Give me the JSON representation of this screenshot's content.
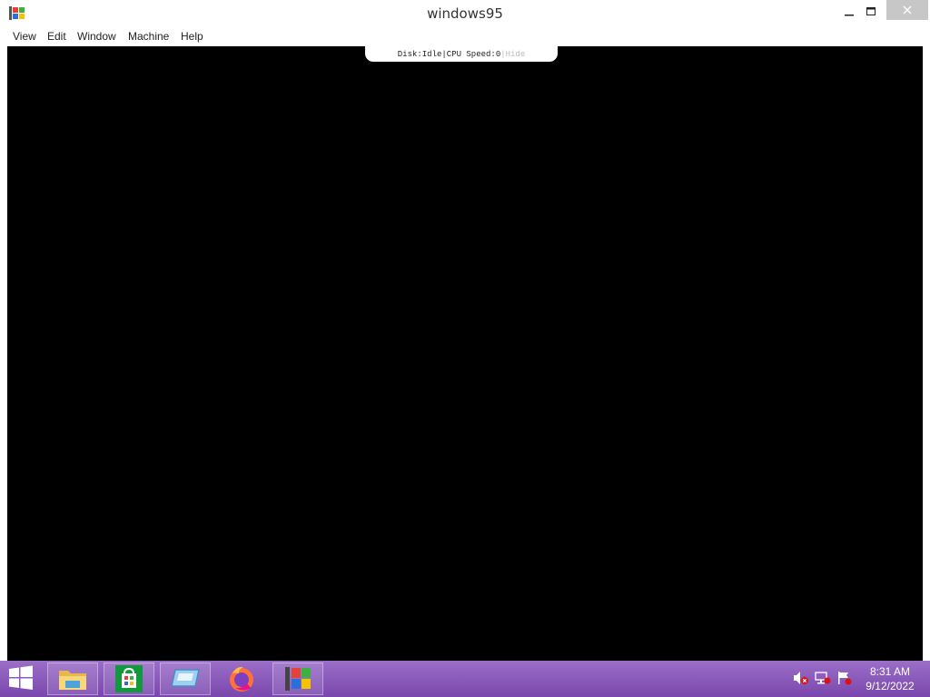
{
  "window": {
    "title": "windows95",
    "icon": "windows-flag-icon",
    "controls": {
      "minimize": "minimize-icon",
      "maximize": "maximize-icon",
      "close": "close-icon"
    }
  },
  "menubar": {
    "items": [
      "View",
      "Edit",
      "Window",
      "Machine",
      "Help"
    ]
  },
  "status": {
    "disk_label": "Disk:",
    "disk_value": "Idle",
    "separator": "|",
    "cpu_label": "CPU Speed:",
    "cpu_value": "0",
    "hide_label": "Hide"
  },
  "taskbar": {
    "start": "windows-start-icon",
    "apps": [
      {
        "name": "file-explorer",
        "icon": "folder-icon",
        "active": true
      },
      {
        "name": "store",
        "icon": "store-bag-icon",
        "active": true
      },
      {
        "name": "remote-desktop",
        "icon": "monitor-icon",
        "active": true
      },
      {
        "name": "firefox",
        "icon": "firefox-icon",
        "active": false
      },
      {
        "name": "windows95",
        "icon": "windows-flag-icon",
        "active": true
      }
    ],
    "tray": [
      "speaker-muted-icon",
      "network-icon",
      "action-center-flag-icon"
    ],
    "clock": {
      "time": "8:31 AM",
      "date": "9/12/2022"
    }
  },
  "colors": {
    "taskbar": "#8a5bbd",
    "screen": "#000000",
    "close_button": "#c7c7c7"
  }
}
